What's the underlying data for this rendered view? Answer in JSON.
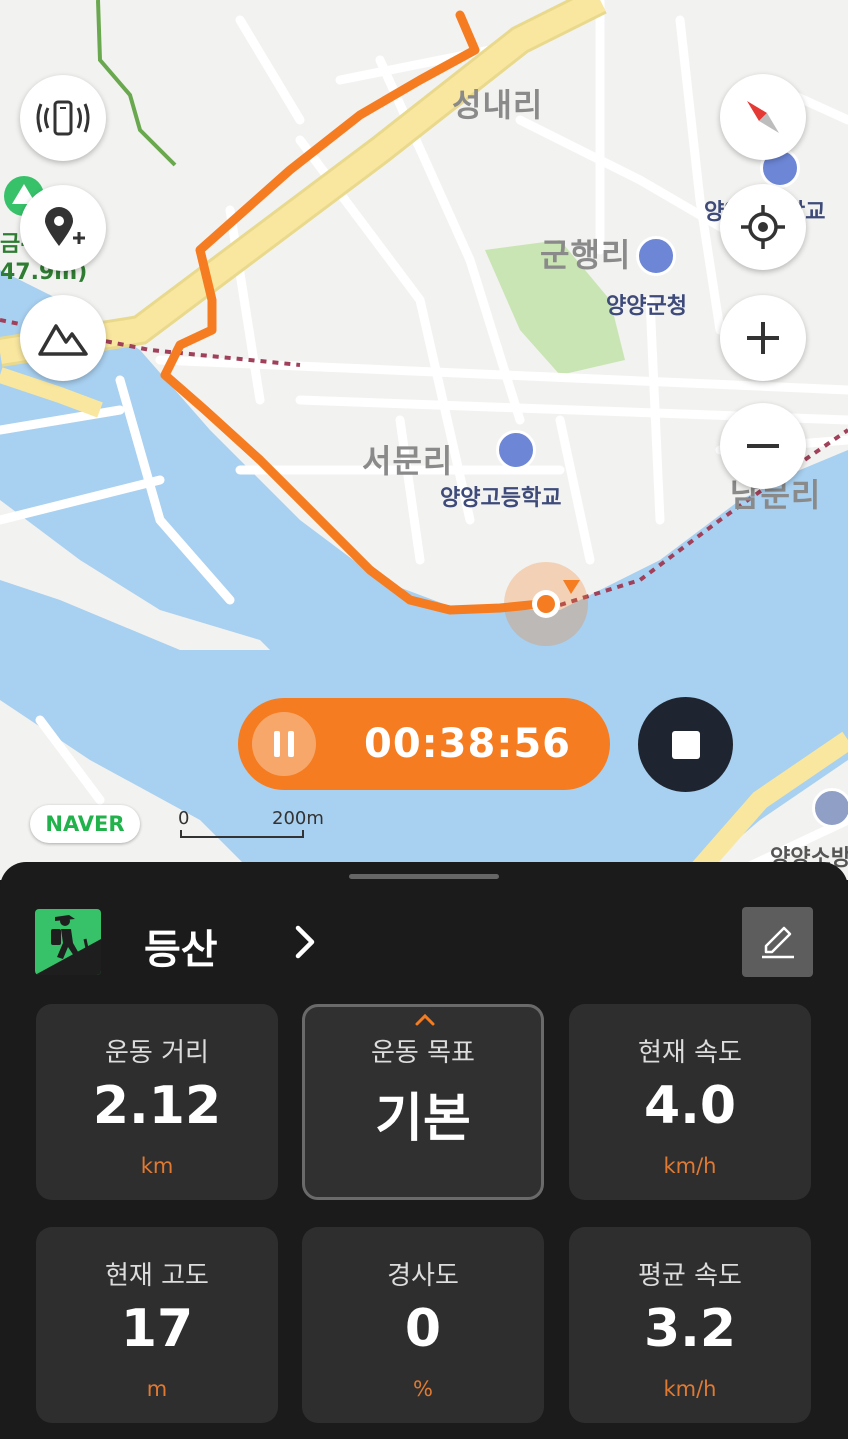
{
  "map": {
    "place_names": [
      "성내리",
      "군행리",
      "서문리",
      "남문리"
    ],
    "pois": [
      "양양군청",
      "양양고등학교",
      "양양초등학교",
      "양양소방서"
    ],
    "left_labels": [
      "금-",
      "47.9m)"
    ],
    "scale": {
      "start": "0",
      "end": "200m"
    },
    "logo": "NAVER",
    "colors": {
      "route": "#f57c20",
      "water": "#a8d0f0",
      "road_major": "#f9e79f",
      "park": "#c9e5b3",
      "trail": "#a0405a"
    }
  },
  "controls": {
    "left": [
      "vibration-icon",
      "add-location-icon",
      "mountain-icon"
    ],
    "right": [
      "compass-icon",
      "my-location-icon",
      "zoom-in-icon",
      "zoom-out-icon"
    ]
  },
  "recording": {
    "timer": "00:38:56",
    "pause_icon": "pause-icon",
    "stop_icon": "stop-icon",
    "accent": "#f57c20"
  },
  "panel": {
    "activity": {
      "name": "등산",
      "icon": "hiking-icon",
      "icon_color": "#37c26a"
    },
    "edit_icon": "pencil-icon",
    "stats": [
      {
        "label": "운동 거리",
        "value": "2.12",
        "unit": "km"
      },
      {
        "label": "운동 목표",
        "value": "기본",
        "unit": ""
      },
      {
        "label": "현재 속도",
        "value": "4.0",
        "unit": "km/h"
      },
      {
        "label": "현재 고도",
        "value": "17",
        "unit": "m"
      },
      {
        "label": "경사도",
        "value": "0",
        "unit": "%"
      },
      {
        "label": "평균 속도",
        "value": "3.2",
        "unit": "km/h"
      }
    ],
    "unit_color": "#e07a32"
  }
}
